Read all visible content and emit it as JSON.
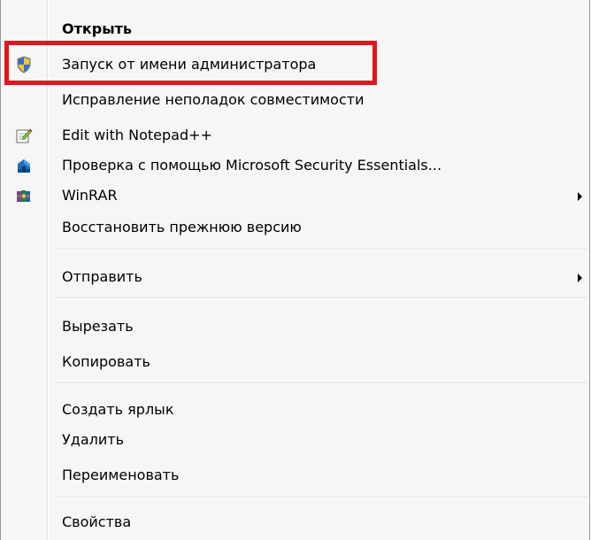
{
  "menu": {
    "items": {
      "open": "Открыть",
      "run_as_admin": "Запуск от имени администратора",
      "troubleshoot": "Исправление неполадок совместимости",
      "notepad": "Edit with Notepad++",
      "mse": "Проверка с помощью Microsoft Security Essentials...",
      "winrar": "WinRAR",
      "restore": "Восстановить прежнюю версию",
      "send_to": "Отправить",
      "cut": "Вырезать",
      "copy": "Копировать",
      "create_shortcut": "Создать ярлык",
      "delete": "Удалить",
      "rename": "Переименовать",
      "properties": "Свойства"
    }
  },
  "icons": {
    "run_as_admin": "uac-shield-icon",
    "notepad": "notepad-plus-plus-icon",
    "mse": "security-essentials-icon",
    "winrar": "winrar-icon"
  },
  "colors": {
    "highlight_border": "#e0161e",
    "menu_background": "#f6f6f6"
  }
}
